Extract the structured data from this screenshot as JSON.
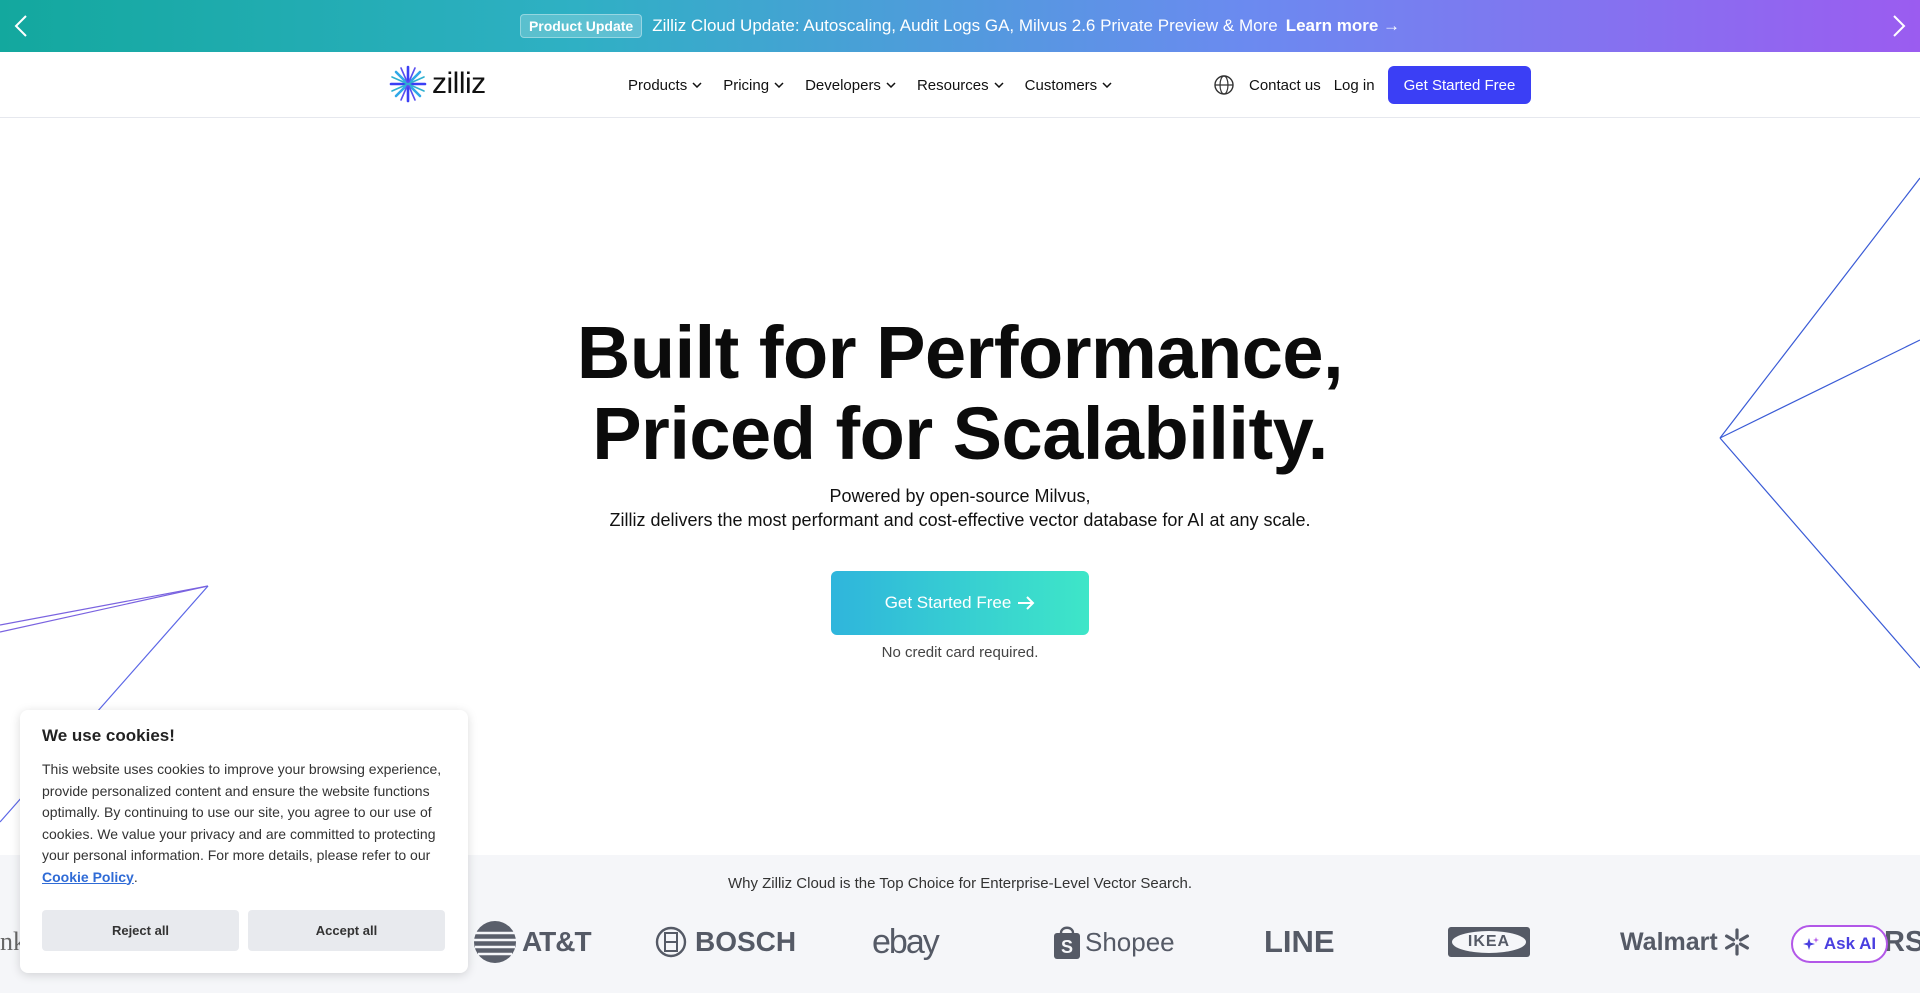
{
  "announcement": {
    "badge": "Product Update",
    "text": "Zilliz Cloud Update: Autoscaling, Audit Logs GA, Milvus 2.6 Private Preview & More",
    "link": "Learn more →"
  },
  "nav": {
    "logo": "zilliz",
    "menu": [
      "Products",
      "Pricing",
      "Developers",
      "Resources",
      "Customers"
    ],
    "contact": "Contact us",
    "login": "Log in",
    "cta": "Get Started Free"
  },
  "hero": {
    "title_line1": "Built for Performance,",
    "title_line2": "Priced for Scalability.",
    "subtitle_line1": "Powered by open-source Milvus,",
    "subtitle_line2": "Zilliz delivers the most performant and cost-effective vector database for AI at any scale.",
    "cta": "Get Started Free",
    "note": "No credit card required."
  },
  "customers": {
    "title": "Why Zilliz Cloud is the Top Choice for Enterprise-Level Vector Search.",
    "logos": [
      "nk",
      "AT&T",
      "BOSCH",
      "ebay",
      "Shopee",
      "LINE",
      "IKEA",
      "Walmart",
      "RS"
    ]
  },
  "ask_ai": "Ask AI",
  "cookie": {
    "title": "We use cookies!",
    "body": "This website uses cookies to improve your browsing experience, provide personalized content and ensure the website functions optimally. By continuing to use our site, you agree to our use of cookies. We value your privacy and are committed to protecting your personal information. For more details, please refer to our ",
    "policy_link": "Cookie Policy",
    "period": ".",
    "reject": "Reject all",
    "accept": "Accept all"
  },
  "colors": {
    "primary": "#3b3ff5",
    "cta_gradient_start": "#2fb5dc",
    "cta_gradient_end": "#3ee6c8"
  }
}
